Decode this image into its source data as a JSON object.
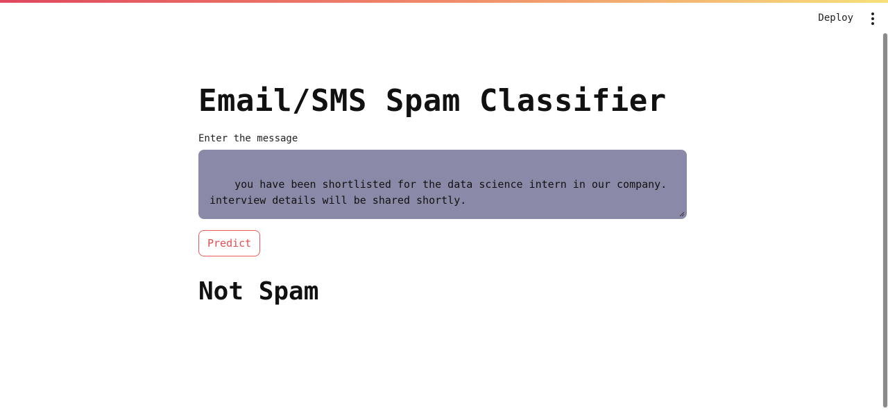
{
  "header": {
    "deploy_label": "Deploy",
    "menu_icon": "vertical-dots-icon"
  },
  "main": {
    "title": "Email/SMS Spam Classifier",
    "input_label": "Enter the message",
    "message_value": "you have been shortlisted for the data science intern in our company.\ninterview details will be shared shortly.",
    "predict_label": "Predict",
    "result": "Not Spam"
  },
  "colors": {
    "accent": "#e84d4d",
    "textarea_bg": "#8a8aa8",
    "top_gradient": [
      "#e0485f",
      "#f08a6a",
      "#f7df7a"
    ]
  }
}
